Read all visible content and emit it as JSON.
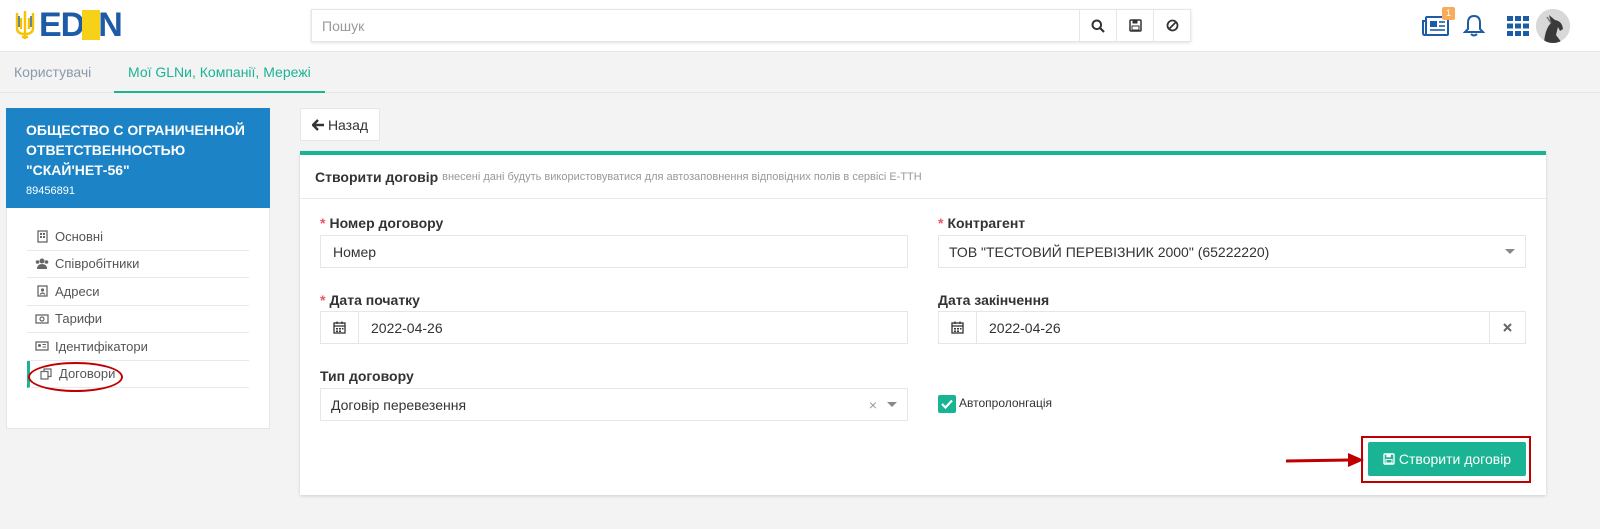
{
  "header": {
    "logo_text_ed": "ED",
    "logo_text_n": "N",
    "search": {
      "placeholder": "Пошук"
    },
    "news_badge": "1",
    "icons": [
      "search-icon",
      "save-icon",
      "ban-icon",
      "news-icon",
      "bell-icon",
      "apps-grid-icon"
    ]
  },
  "tabs": [
    {
      "label": "Користувачі",
      "active": false
    },
    {
      "label": "Мої GLNи, Компанії, Мережі",
      "active": true
    }
  ],
  "company": {
    "name": "ОБЩЕСТВО С ОГРАНИЧЕННОЙ ОТВЕТСТВЕННОСТЬЮ \"СКАЙ'НЕТ-56\"",
    "id": "89456891"
  },
  "menu": {
    "items": [
      {
        "label": "Основні",
        "icon": "building-icon"
      },
      {
        "label": "Співробітники",
        "icon": "users-icon"
      },
      {
        "label": "Адреси",
        "icon": "address-card-icon"
      },
      {
        "label": "Тарифи",
        "icon": "money-icon"
      },
      {
        "label": "Ідентифікатори",
        "icon": "id-card-icon"
      },
      {
        "label": "Договори",
        "icon": "copy-icon"
      }
    ]
  },
  "back_label": "Назад",
  "form": {
    "title": "Створити договір",
    "subtitle": "внесені дані будуть використовуватися для автозаповнення відповідних полів в сервісі Е-ТТН",
    "contract_number": {
      "label": "Номер договору",
      "value": "Номер"
    },
    "counterparty": {
      "label": "Контрагент",
      "value": "ТОВ \"ТЕСТОВИЙ ПЕРЕВІЗНИК 2000\" (65222220)"
    },
    "start_date": {
      "label": "Дата початку",
      "value": "2022-04-26"
    },
    "end_date": {
      "label": "Дата закінчення",
      "value": "2022-04-26"
    },
    "contract_type": {
      "label": "Тип договору",
      "value": "Договір перевезення"
    },
    "autoprolong": {
      "label": "Автопролонгація",
      "checked": true
    },
    "submit_label": "Створити договір"
  },
  "colors": {
    "accent": "#1ab394",
    "company_bg": "#1c84c6",
    "annotation": "#c00000",
    "required": "#ed5565"
  }
}
